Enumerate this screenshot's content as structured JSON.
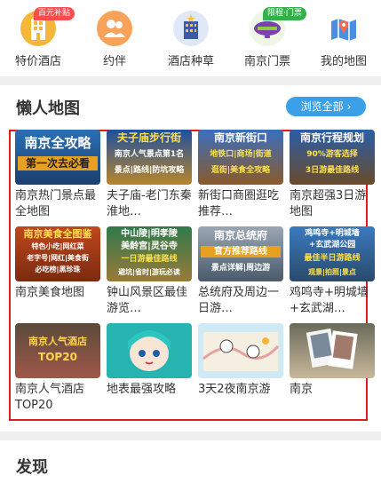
{
  "nav": {
    "items": [
      {
        "label": "特价酒店",
        "badge": "百元补贴",
        "icon": "hotel-building-icon"
      },
      {
        "label": "约伴",
        "icon": "companion-people-icon"
      },
      {
        "label": "酒店种草",
        "icon": "hotel-recommend-icon"
      },
      {
        "label": "南京门票",
        "badge": "限程·门票",
        "icon": "ticket-blimp-icon"
      },
      {
        "label": "我的地图",
        "icon": "map-pin-icon"
      }
    ]
  },
  "lazy_map": {
    "title": "懒人地图",
    "browse_all": "浏览全部",
    "browse_arrow": "›",
    "cards": [
      {
        "title": "南京热门景点最全地图",
        "thumb": [
          "南京全攻略",
          "第一次去必看"
        ]
      },
      {
        "title": "夫子庙-老门东秦淮地…",
        "thumb": [
          "夫子庙步行街",
          "南京人气景点第1名",
          "景点|路线|防坑攻略"
        ]
      },
      {
        "title": "新街口商圈逛吃推荐…",
        "thumb": [
          "南京新街口",
          "地铁口|商场|街道",
          "逛街|美食全攻略"
        ]
      },
      {
        "title": "南京超强3日游地图",
        "thumb": [
          "南京行程规划",
          "90%游客选择",
          "3日游最佳路线"
        ]
      },
      {
        "title": "南京美食地图",
        "thumb": [
          "南京美食全图鉴",
          "特色小吃|网红菜",
          "老字号|网红|美食街",
          "必吃榜|黑珍珠"
        ]
      },
      {
        "title": "钟山风景区最佳游览…",
        "thumb": [
          "中山陵|明孝陵",
          "美龄宫|灵谷寺",
          "一日游最佳路线",
          "避坑|省时|游玩必读"
        ]
      },
      {
        "title": "总统府及周边一日游…",
        "thumb": [
          "南京总统府",
          "官方推荐路线",
          "景点详解|周边游"
        ]
      },
      {
        "title": "鸡鸣寺+明城墙+玄武湖…",
        "thumb": [
          "鸡鸣寺+明城墙",
          "+玄武湖公园",
          "最佳半日游路线",
          "观景|拍照|景点"
        ]
      },
      {
        "title": "南京人气酒店TOP20",
        "thumb": [
          "南京人气酒店",
          "TOP20"
        ]
      },
      {
        "title": "地表最强攻略",
        "thumb": []
      },
      {
        "title": "3天2夜南京游",
        "thumb": []
      },
      {
        "title": "南京",
        "thumb": []
      }
    ]
  },
  "discover": {
    "title": "发现"
  },
  "colors": {
    "accent": "#3aa0e8",
    "highlight_frame": "#e01b1b",
    "badge": "#ff4d4f"
  }
}
